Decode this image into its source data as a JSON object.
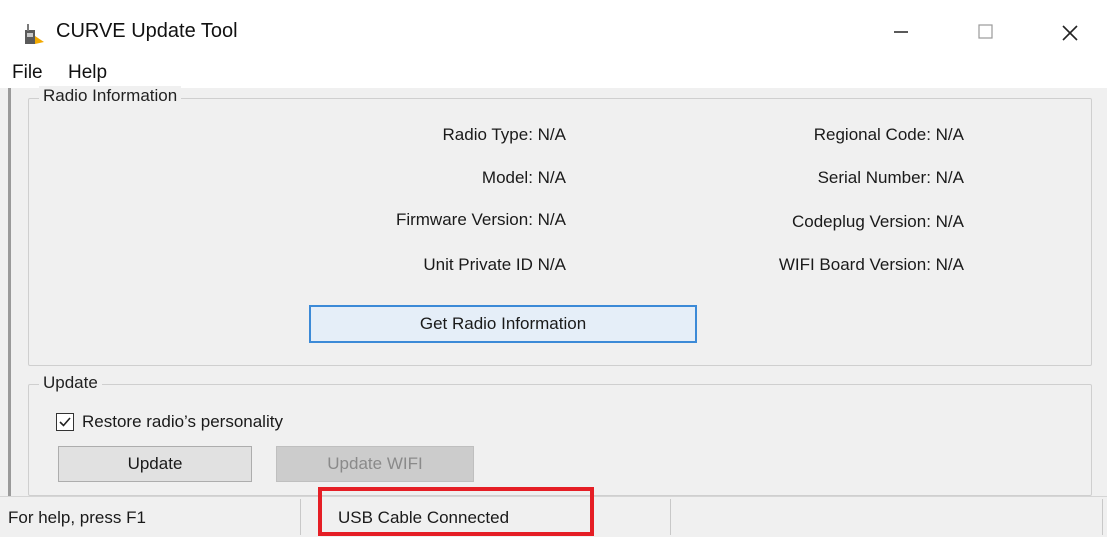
{
  "window": {
    "title": "CURVE Update Tool",
    "icon": "app-radio-icon"
  },
  "menu": {
    "file": "File",
    "help": "Help"
  },
  "radio_info": {
    "group_label": "Radio Information",
    "radio_type": "Radio Type:  N/A",
    "model": "Model:  N/A",
    "firmware_version": "Firmware Version:  N/A",
    "unit_private_id": "Unit Private ID  N/A",
    "regional_code": "Regional Code: N/A",
    "serial_number": "Serial Number: N/A",
    "codeplug_version": "Codeplug Version: N/A",
    "wifi_board_version": "WIFI Board Version:  N/A",
    "get_info_button": "Get Radio Information"
  },
  "update": {
    "group_label": "Update",
    "restore_label": "Restore radio’s personality",
    "restore_checked": true,
    "update_button": "Update",
    "update_wifi_button": "Update WIFI"
  },
  "status": {
    "help_text": "For help, press F1",
    "connection_text": "USB Cable Connected",
    "highlight_color": "#e51e25"
  }
}
